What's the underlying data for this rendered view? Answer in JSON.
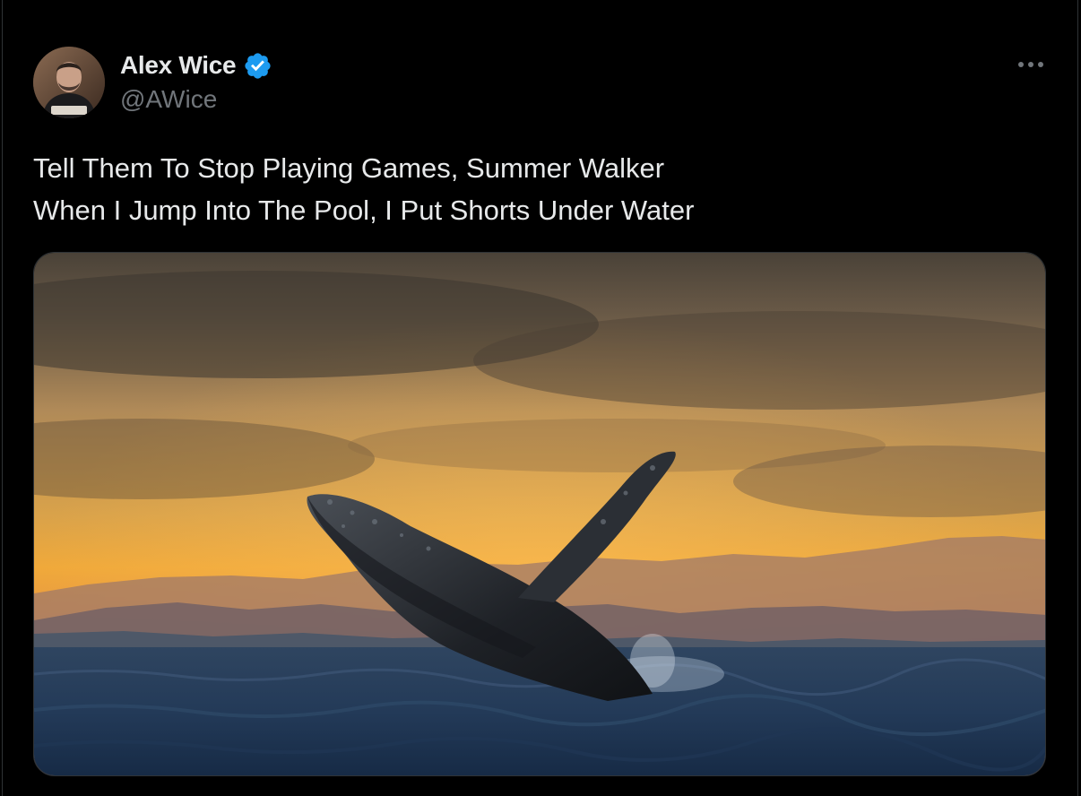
{
  "tweet": {
    "author": {
      "display_name": "Alex Wice",
      "handle": "@AWice",
      "verified": true,
      "avatar_icon": "profile-photo"
    },
    "more_icon": "more-horizontal-icon",
    "text_lines": [
      "Tell Them To Stop Playing Games, Summer Walker",
      "When I Jump Into The Pool, I Put Shorts Under Water"
    ],
    "media": {
      "type": "photo",
      "subject": "humpback-whale-breaching-at-sunset"
    }
  },
  "colors": {
    "background": "#000000",
    "text_primary": "#e7e9ea",
    "text_secondary": "#71767b",
    "verified_blue": "#1d9bf0",
    "border": "#2f3336"
  }
}
